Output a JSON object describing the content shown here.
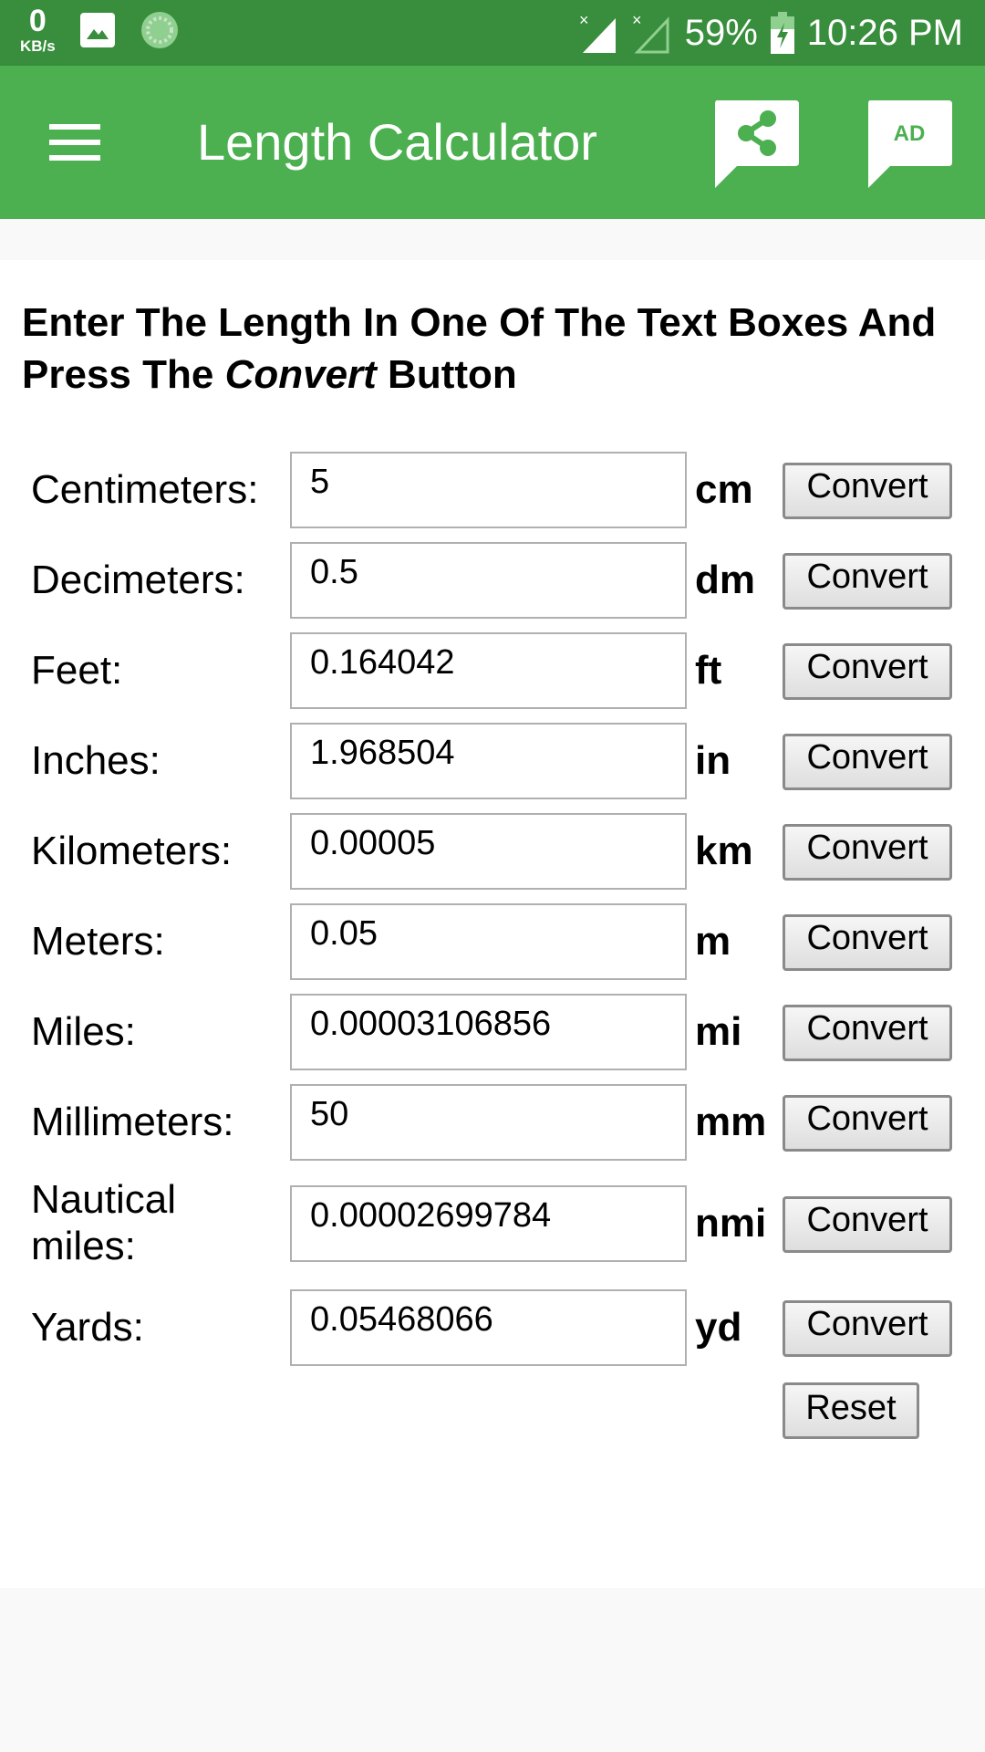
{
  "status_bar": {
    "net_speed_value": "0",
    "net_speed_unit": "KB/s",
    "battery": "59%",
    "time": "10:26 PM",
    "icons": [
      "gallery-icon",
      "sync-icon",
      "signal-no-sim-icon",
      "signal-empty-icon",
      "battery-charging-icon"
    ]
  },
  "toolbar": {
    "title": "Length Calculator",
    "menu_icon": "hamburger-menu-icon",
    "share_icon": "share-icon",
    "ad_label": "AD"
  },
  "instructions": {
    "part1": "Enter The Length In One Of The Text Boxes And Press The ",
    "emphasis": "Convert",
    "part2": " Button"
  },
  "rows": [
    {
      "label": "Centimeters:",
      "value": "5",
      "unit": "cm",
      "button": "Convert"
    },
    {
      "label": "Decimeters:",
      "value": "0.5",
      "unit": "dm",
      "button": "Convert"
    },
    {
      "label": "Feet:",
      "value": "0.164042",
      "unit": "ft",
      "button": "Convert"
    },
    {
      "label": "Inches:",
      "value": "1.968504",
      "unit": "in",
      "button": "Convert"
    },
    {
      "label": "Kilometers:",
      "value": "0.00005",
      "unit": "km",
      "button": "Convert"
    },
    {
      "label": "Meters:",
      "value": "0.05",
      "unit": "m",
      "button": "Convert"
    },
    {
      "label": "Miles:",
      "value": "0.00003106856",
      "unit": "mi",
      "button": "Convert"
    },
    {
      "label": "Millimeters:",
      "value": "50",
      "unit": "mm",
      "button": "Convert"
    },
    {
      "label": "Nautical miles:",
      "value": "0.00002699784",
      "unit": "nmi",
      "button": "Convert"
    },
    {
      "label": "Yards:",
      "value": "0.05468066",
      "unit": "yd",
      "button": "Convert"
    }
  ],
  "reset_label": "Reset",
  "colors": {
    "status_bar": "#388e3c",
    "toolbar": "#4caf50",
    "background": "#f9f9f9"
  }
}
